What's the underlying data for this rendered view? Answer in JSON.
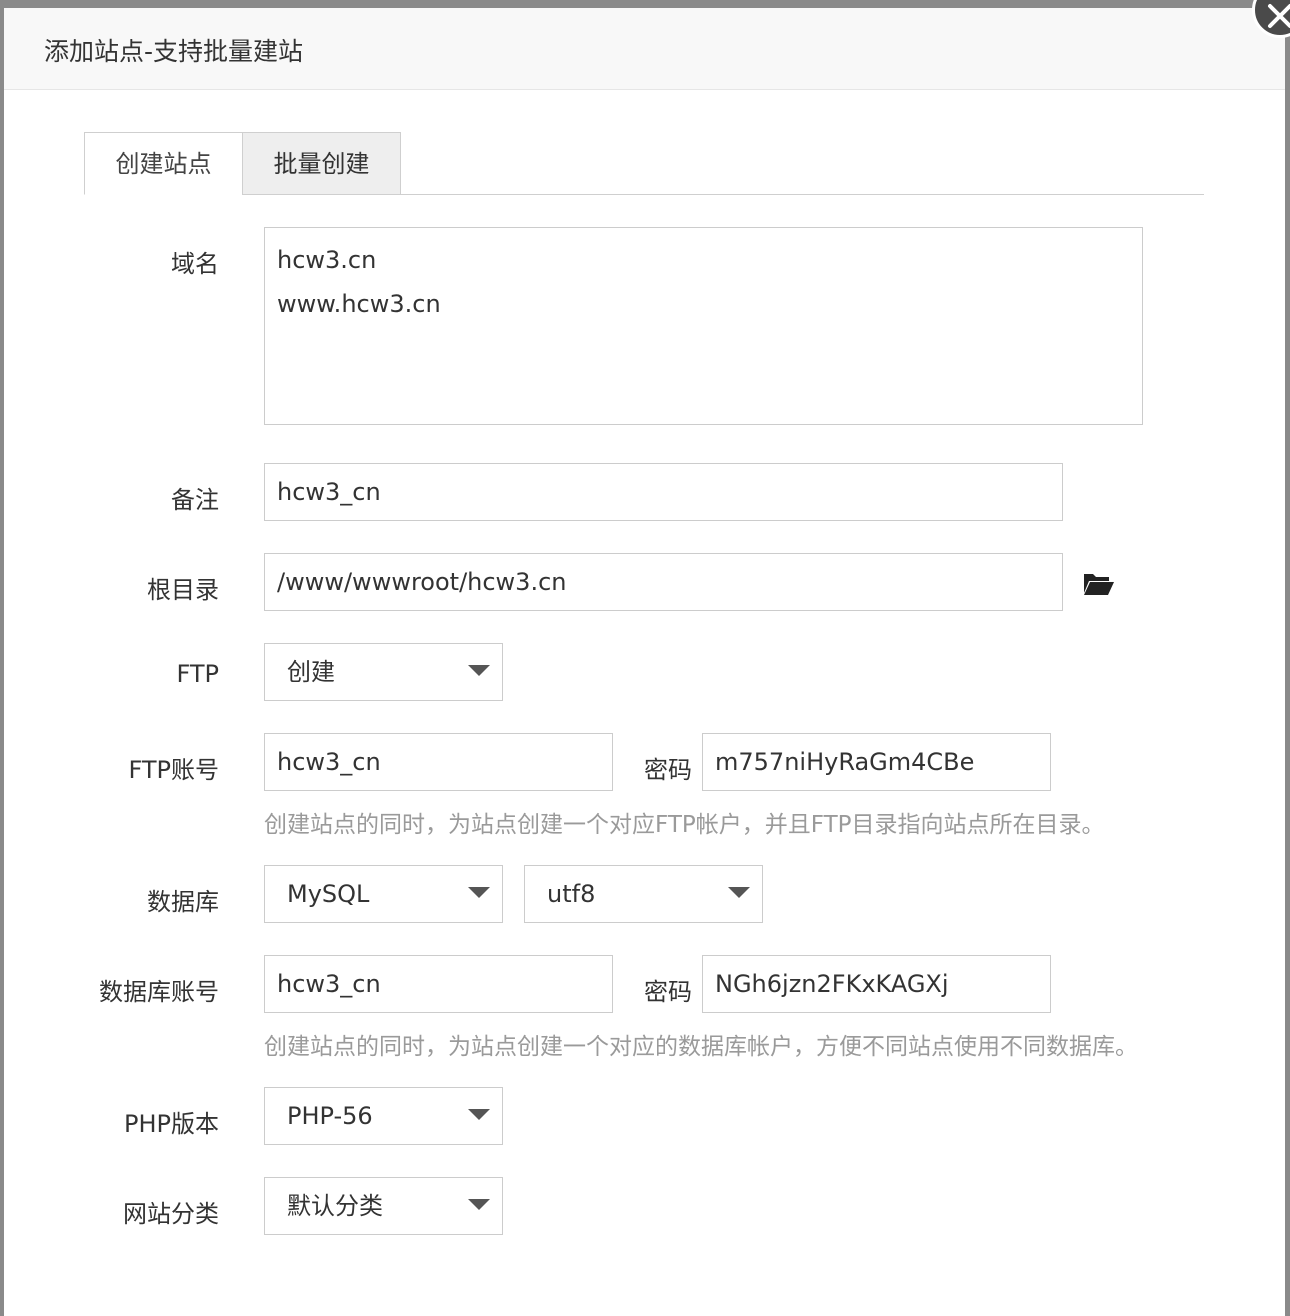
{
  "dialog": {
    "title": "添加站点-支持批量建站",
    "close_icon": "close-icon"
  },
  "tabs": [
    {
      "label": "创建站点",
      "active": true
    },
    {
      "label": "批量创建",
      "active": false
    }
  ],
  "form": {
    "domain": {
      "label": "域名",
      "lines": [
        "hcw3.cn",
        "www.hcw3.cn"
      ]
    },
    "remark": {
      "label": "备注",
      "value": "hcw3_cn"
    },
    "root_dir": {
      "label": "根目录",
      "value": "/www/wwwroot/hcw3.cn",
      "icon": "folder-open-icon"
    },
    "ftp": {
      "label": "FTP",
      "selected": "创建"
    },
    "ftp_account": {
      "label": "FTP账号",
      "value": "hcw3_cn",
      "password_label": "密码",
      "password": "m757niHyRaGm4CBe",
      "hint": "创建站点的同时，为站点创建一个对应FTP帐户，并且FTP目录指向站点所在目录。"
    },
    "database": {
      "label": "数据库",
      "selected": "MySQL",
      "charset": "utf8"
    },
    "db_account": {
      "label": "数据库账号",
      "value": "hcw3_cn",
      "password_label": "密码",
      "password": "NGh6jzn2FKxKAGXj",
      "hint": "创建站点的同时，为站点创建一个对应的数据库帐户，方便不同站点使用不同数据库。"
    },
    "php_version": {
      "label": "PHP版本",
      "selected": "PHP-56"
    },
    "category": {
      "label": "网站分类",
      "selected": "默认分类"
    }
  }
}
